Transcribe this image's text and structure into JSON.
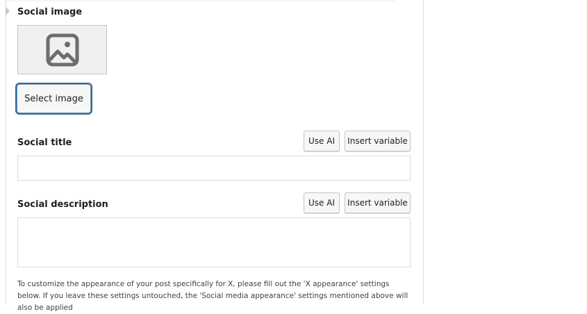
{
  "social_image": {
    "label": "Social image",
    "select_button": "Select image"
  },
  "social_title": {
    "label": "Social title",
    "use_ai": "Use AI",
    "insert_variable": "Insert variable",
    "value": ""
  },
  "social_description": {
    "label": "Social description",
    "use_ai": "Use AI",
    "insert_variable": "Insert variable",
    "value": ""
  },
  "help_text": "To customize the appearance of your post specifically for X, please fill out the 'X appearance' settings below. If you leave these settings untouched, the 'Social media appearance' settings mentioned above will also be applied"
}
